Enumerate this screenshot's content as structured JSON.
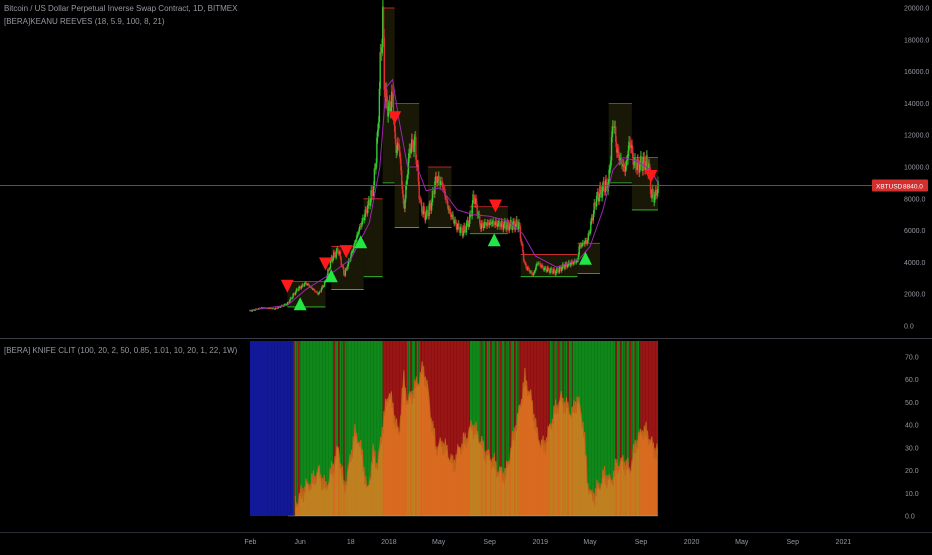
{
  "header": {
    "title": "Bitcoin / US Dollar Perpetual Inverse Swap Contract, 1D, BITMEX",
    "indicator_top": "[BERA]KEANU REEVES (18, 5.9, 100, 8, 21)",
    "indicator_bottom": "[BERA] KNIFE CLIT (100, 20, 2, 50, 0.85, 1.01, 10, 20, 1, 22, 1W)"
  },
  "colors": {
    "background": "#000000",
    "up": "#33cc33",
    "down": "#e03030",
    "ma": "#9c27b0",
    "price_line": "#d32f2f",
    "bull_signal": "#22e644",
    "bear_signal": "#ff1a1a",
    "osc_fill": "#e67e22",
    "osc_line": "#c0641a",
    "bg_green": "#0f8a1a",
    "bg_red": "#9b1515",
    "bg_blue": "#121999",
    "badge": "#d32f2f"
  },
  "price_label": {
    "symbol": "XBTUSD",
    "value": "8840.0"
  },
  "chart_data": [
    {
      "type": "candlestick",
      "price_axis_ticks": [
        "20000.0",
        "18000.0",
        "16000.0",
        "14000.0",
        "12000.0",
        "10000.0",
        "8000.0",
        "6000.0",
        "4000.0",
        "2000.0",
        "0.0"
      ],
      "price_axis_values": [
        20000,
        18000,
        16000,
        14000,
        12000,
        10000,
        8000,
        6000,
        4000,
        2000,
        0
      ],
      "ylim": [
        -500,
        20200
      ],
      "time_axis_ticks": [
        "Feb",
        "Jun",
        "18",
        "2018",
        "May",
        "Sep",
        "2019",
        "May",
        "Sep",
        "2020",
        "May",
        "Sep",
        "2021"
      ],
      "close_series": [
        [
          "2017-01-31",
          940
        ],
        [
          "2017-03-01",
          1150
        ],
        [
          "2017-04-01",
          1080
        ],
        [
          "2017-05-01",
          1400
        ],
        [
          "2017-05-25",
          2300
        ],
        [
          "2017-06-15",
          2700
        ],
        [
          "2017-07-15",
          2000
        ],
        [
          "2017-08-01",
          2800
        ],
        [
          "2017-08-15",
          4200
        ],
        [
          "2017-09-01",
          4800
        ],
        [
          "2017-09-15",
          3200
        ],
        [
          "2017-10-01",
          4400
        ],
        [
          "2017-10-20",
          6000
        ],
        [
          "2017-11-01",
          6800
        ],
        [
          "2017-11-15",
          7800
        ],
        [
          "2017-11-25",
          8800
        ],
        [
          "2017-12-05",
          12000
        ],
        [
          "2017-12-10",
          15800
        ],
        [
          "2017-12-17",
          19500
        ],
        [
          "2017-12-22",
          14500
        ],
        [
          "2018-01-01",
          13500
        ],
        [
          "2018-01-10",
          14500
        ],
        [
          "2018-01-17",
          11000
        ],
        [
          "2018-01-25",
          11500
        ],
        [
          "2018-02-06",
          7200
        ],
        [
          "2018-02-15",
          9800
        ],
        [
          "2018-02-20",
          11200
        ],
        [
          "2018-03-05",
          11500
        ],
        [
          "2018-03-18",
          7500
        ],
        [
          "2018-04-01",
          6900
        ],
        [
          "2018-04-12",
          7600
        ],
        [
          "2018-04-25",
          9300
        ],
        [
          "2018-05-10",
          8900
        ],
        [
          "2018-05-25",
          7300
        ],
        [
          "2018-06-13",
          6300
        ],
        [
          "2018-06-29",
          5900
        ],
        [
          "2018-07-15",
          6700
        ],
        [
          "2018-07-25",
          8200
        ],
        [
          "2018-08-10",
          6300
        ],
        [
          "2018-09-05",
          6500
        ],
        [
          "2018-10-10",
          6300
        ],
        [
          "2018-11-10",
          6400
        ],
        [
          "2018-11-20",
          4600
        ],
        [
          "2018-11-25",
          3800
        ],
        [
          "2018-12-15",
          3200
        ],
        [
          "2018-12-25",
          4000
        ],
        [
          "2019-01-10",
          3600
        ],
        [
          "2019-02-07",
          3400
        ],
        [
          "2019-03-01",
          3800
        ],
        [
          "2019-04-01",
          4100
        ],
        [
          "2019-04-05",
          5000
        ],
        [
          "2019-04-25",
          5400
        ],
        [
          "2019-05-15",
          7900
        ],
        [
          "2019-05-30",
          8600
        ],
        [
          "2019-06-15",
          9000
        ],
        [
          "2019-06-26",
          13000
        ],
        [
          "2019-07-05",
          11000
        ],
        [
          "2019-07-15",
          10300
        ],
        [
          "2019-07-25",
          9800
        ],
        [
          "2019-08-05",
          11700
        ],
        [
          "2019-08-15",
          10200
        ],
        [
          "2019-08-25",
          10100
        ],
        [
          "2019-09-10",
          10300
        ],
        [
          "2019-09-20",
          10000
        ],
        [
          "2019-09-25",
          8300
        ],
        [
          "2019-10-05",
          8100
        ],
        [
          "2019-10-12",
          8840
        ]
      ],
      "ma_series": [
        [
          "2017-02-01",
          1000
        ],
        [
          "2017-05-01",
          1300
        ],
        [
          "2017-06-15",
          2300
        ],
        [
          "2017-08-15",
          3300
        ],
        [
          "2017-10-01",
          4200
        ],
        [
          "2017-11-15",
          6500
        ],
        [
          "2017-12-10",
          10000
        ],
        [
          "2017-12-25",
          15000
        ],
        [
          "2018-01-10",
          15500
        ],
        [
          "2018-01-25",
          13000
        ],
        [
          "2018-02-15",
          10000
        ],
        [
          "2018-03-10",
          10000
        ],
        [
          "2018-04-01",
          8500
        ],
        [
          "2018-05-05",
          8700
        ],
        [
          "2018-06-15",
          7300
        ],
        [
          "2018-07-25",
          7000
        ],
        [
          "2018-09-01",
          6900
        ],
        [
          "2018-10-15",
          6600
        ],
        [
          "2018-11-20",
          5800
        ],
        [
          "2018-12-20",
          4400
        ],
        [
          "2019-02-10",
          3700
        ],
        [
          "2019-04-05",
          4200
        ],
        [
          "2019-05-01",
          5000
        ],
        [
          "2019-06-01",
          7300
        ],
        [
          "2019-06-25",
          9800
        ],
        [
          "2019-07-20",
          10600
        ],
        [
          "2019-08-20",
          10400
        ],
        [
          "2019-09-25",
          9800
        ],
        [
          "2019-10-12",
          9000
        ]
      ],
      "bull_signals": [
        "2017-06-01",
        "2017-08-15",
        "2017-10-25",
        "2018-09-12",
        "2019-04-20"
      ],
      "bear_signals": [
        "2017-05-01",
        "2017-08-01",
        "2017-09-20",
        "2018-01-15",
        "2018-09-15",
        "2019-09-25"
      ],
      "support_resistance_boxes": [
        {
          "x0": "2017-05-01",
          "x1": "2017-08-01",
          "y0": 1200,
          "y1": 2800
        },
        {
          "x0": "2017-08-15",
          "x1": "2017-11-01",
          "y0": 2300,
          "y1": 5000
        },
        {
          "x0": "2017-11-01",
          "x1": "2017-12-17",
          "y0": 3100,
          "y1": 8000
        },
        {
          "x0": "2017-12-17",
          "x1": "2018-01-15",
          "y0": 9000,
          "y1": 20000
        },
        {
          "x0": "2018-01-15",
          "x1": "2018-03-15",
          "y0": 6200,
          "y1": 14000
        },
        {
          "x0": "2018-04-05",
          "x1": "2018-06-01",
          "y0": 6200,
          "y1": 10000
        },
        {
          "x0": "2018-07-15",
          "x1": "2018-10-15",
          "y0": 5800,
          "y1": 7500
        },
        {
          "x0": "2018-11-15",
          "x1": "2019-04-01",
          "y0": 3100,
          "y1": 4500
        },
        {
          "x0": "2019-04-01",
          "x1": "2019-05-25",
          "y0": 3300,
          "y1": 5200
        },
        {
          "x0": "2019-06-15",
          "x1": "2019-08-10",
          "y0": 9000,
          "y1": 14000
        },
        {
          "x0": "2019-08-10",
          "x1": "2019-10-12",
          "y0": 7300,
          "y1": 10600
        }
      ]
    },
    {
      "type": "area",
      "axis_ticks": [
        "70.0",
        "60.0",
        "50.0",
        "40.0",
        "30.0",
        "20.0",
        "10.0",
        "0.0"
      ],
      "axis_values": [
        70,
        60,
        50,
        40,
        30,
        20,
        10,
        0
      ],
      "ylim": [
        -10,
        77
      ],
      "oscillator_series": [
        [
          "2017-05-20",
          5
        ],
        [
          "2017-06-15",
          13
        ],
        [
          "2017-07-01",
          15
        ],
        [
          "2017-07-15",
          20
        ],
        [
          "2017-08-01",
          12
        ],
        [
          "2017-08-20",
          22
        ],
        [
          "2017-09-01",
          30
        ],
        [
          "2017-09-15",
          12
        ],
        [
          "2017-09-25",
          20
        ],
        [
          "2017-10-10",
          36
        ],
        [
          "2017-10-20",
          34
        ],
        [
          "2017-10-30",
          25
        ],
        [
          "2017-11-10",
          10
        ],
        [
          "2017-11-25",
          28
        ],
        [
          "2017-12-05",
          22
        ],
        [
          "2017-12-17",
          40
        ],
        [
          "2018-01-01",
          55
        ],
        [
          "2018-01-10",
          48
        ],
        [
          "2018-01-25",
          35
        ],
        [
          "2018-02-05",
          60
        ],
        [
          "2018-02-15",
          50
        ],
        [
          "2018-03-01",
          55
        ],
        [
          "2018-03-15",
          60
        ],
        [
          "2018-03-25",
          65
        ],
        [
          "2018-04-05",
          55
        ],
        [
          "2018-04-15",
          40
        ],
        [
          "2018-04-25",
          30
        ],
        [
          "2018-05-10",
          32
        ],
        [
          "2018-05-25",
          27
        ],
        [
          "2018-06-05",
          22
        ],
        [
          "2018-06-20",
          30
        ],
        [
          "2018-07-05",
          33
        ],
        [
          "2018-07-20",
          40
        ],
        [
          "2018-08-05",
          35
        ],
        [
          "2018-08-20",
          28
        ],
        [
          "2018-09-05",
          25
        ],
        [
          "2018-09-20",
          20
        ],
        [
          "2018-10-10",
          18
        ],
        [
          "2018-10-25",
          32
        ],
        [
          "2018-11-10",
          45
        ],
        [
          "2018-11-25",
          60
        ],
        [
          "2018-12-10",
          52
        ],
        [
          "2018-12-25",
          35
        ],
        [
          "2019-01-10",
          30
        ],
        [
          "2019-02-01",
          44
        ],
        [
          "2019-02-20",
          52
        ],
        [
          "2019-03-05",
          48
        ],
        [
          "2019-03-20",
          45
        ],
        [
          "2019-04-01",
          52
        ],
        [
          "2019-04-15",
          40
        ],
        [
          "2019-04-25",
          15
        ],
        [
          "2019-05-05",
          8
        ],
        [
          "2019-05-20",
          12
        ],
        [
          "2019-06-05",
          18
        ],
        [
          "2019-06-20",
          15
        ],
        [
          "2019-07-05",
          22
        ],
        [
          "2019-07-20",
          24
        ],
        [
          "2019-08-05",
          20
        ],
        [
          "2019-08-20",
          32
        ],
        [
          "2019-09-05",
          38
        ],
        [
          "2019-09-20",
          35
        ],
        [
          "2019-10-01",
          30
        ],
        [
          "2019-10-12",
          28
        ]
      ],
      "background_regimes": [
        {
          "from": "2017-01-31",
          "to": "2017-05-15",
          "state": "blue"
        },
        {
          "from": "2017-05-15",
          "to": "2017-06-01",
          "state": "mixed"
        },
        {
          "from": "2017-06-01",
          "to": "2017-08-20",
          "state": "green"
        },
        {
          "from": "2017-08-20",
          "to": "2017-09-20",
          "state": "mixed"
        },
        {
          "from": "2017-09-20",
          "to": "2017-12-17",
          "state": "green"
        },
        {
          "from": "2017-12-17",
          "to": "2018-02-10",
          "state": "red"
        },
        {
          "from": "2018-02-10",
          "to": "2018-03-20",
          "state": "mixed"
        },
        {
          "from": "2018-03-20",
          "to": "2018-07-15",
          "state": "red"
        },
        {
          "from": "2018-07-15",
          "to": "2018-08-10",
          "state": "green"
        },
        {
          "from": "2018-08-10",
          "to": "2018-11-10",
          "state": "mixed"
        },
        {
          "from": "2018-11-10",
          "to": "2019-01-20",
          "state": "red"
        },
        {
          "from": "2019-01-20",
          "to": "2019-03-20",
          "state": "mixed"
        },
        {
          "from": "2019-03-20",
          "to": "2019-07-01",
          "state": "green"
        },
        {
          "from": "2019-07-01",
          "to": "2019-09-01",
          "state": "mixed"
        },
        {
          "from": "2019-09-01",
          "to": "2019-10-12",
          "state": "red"
        }
      ]
    }
  ]
}
